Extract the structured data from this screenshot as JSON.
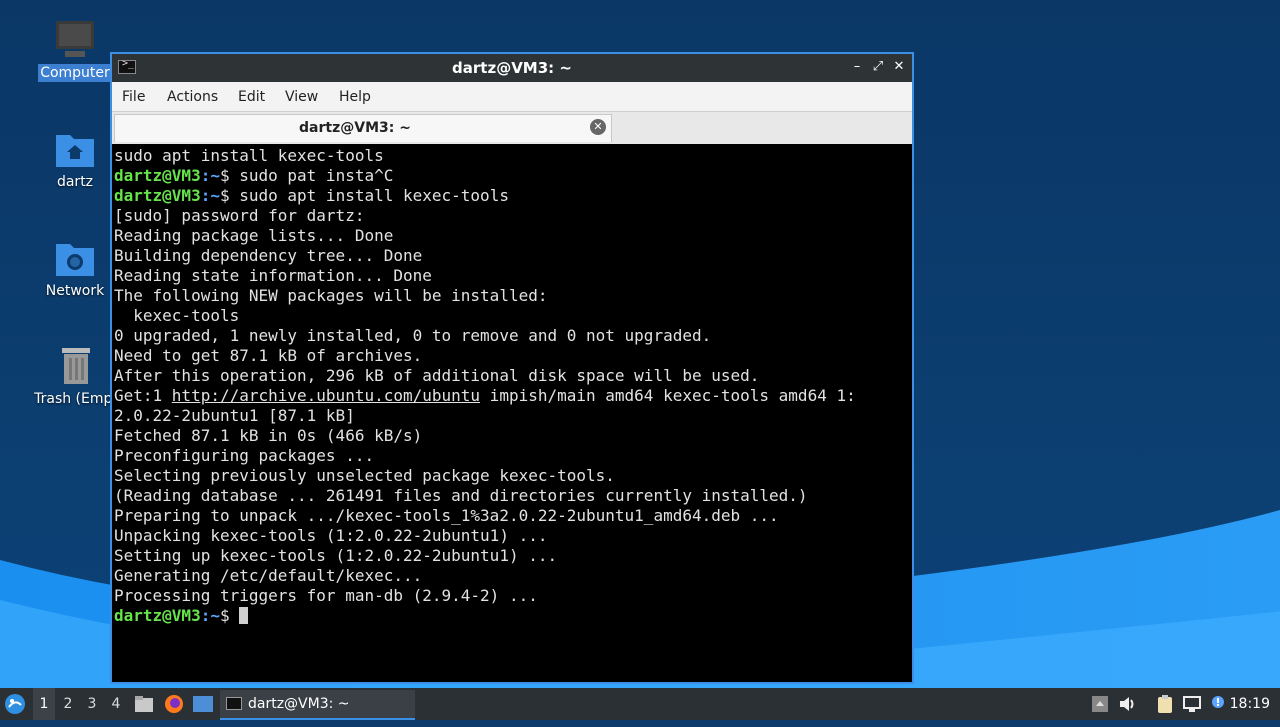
{
  "desktop": {
    "icons": [
      {
        "label": "Computer",
        "icon": "computer-icon",
        "selected": true
      },
      {
        "label": "dartz",
        "icon": "home-folder-icon"
      },
      {
        "label": "Network",
        "icon": "network-folder-icon"
      },
      {
        "label": "Trash (Empt",
        "icon": "trash-icon"
      }
    ]
  },
  "window": {
    "title": "dartz@VM3: ~",
    "menu": [
      "File",
      "Actions",
      "Edit",
      "View",
      "Help"
    ],
    "tab_title": "dartz@VM3: ~",
    "controls": [
      "minimize",
      "maximize",
      "close"
    ]
  },
  "terminal": {
    "prompt_user": "dartz@VM3",
    "prompt_path": ":~",
    "prompt_symbol": "$ ",
    "lines": [
      {
        "text": "sudo apt install kexec-tools"
      },
      {
        "prompt": true,
        "text": "sudo pat insta^C"
      },
      {
        "prompt": true,
        "text": "sudo apt install kexec-tools"
      },
      {
        "text": "[sudo] password for dartz:"
      },
      {
        "text": "Reading package lists... Done"
      },
      {
        "text": "Building dependency tree... Done"
      },
      {
        "text": "Reading state information... Done"
      },
      {
        "text": "The following NEW packages will be installed:"
      },
      {
        "text": "  kexec-tools"
      },
      {
        "text": "0 upgraded, 1 newly installed, 0 to remove and 0 not upgraded."
      },
      {
        "text": "Need to get 87.1 kB of archives."
      },
      {
        "text": "After this operation, 296 kB of additional disk space will be used."
      },
      {
        "text": "Get:1 ",
        "url": "http://archive.ubuntu.com/ubuntu",
        "rest": " impish/main amd64 kexec-tools amd64 1:"
      },
      {
        "text": "2.0.22-2ubuntu1 [87.1 kB]"
      },
      {
        "text": "Fetched 87.1 kB in 0s (466 kB/s)"
      },
      {
        "text": "Preconfiguring packages ..."
      },
      {
        "text": "Selecting previously unselected package kexec-tools."
      },
      {
        "text": "(Reading database ... 261491 files and directories currently installed.)"
      },
      {
        "text": "Preparing to unpack .../kexec-tools_1%3a2.0.22-2ubuntu1_amd64.deb ..."
      },
      {
        "text": "Unpacking kexec-tools (1:2.0.22-2ubuntu1) ..."
      },
      {
        "text": "Setting up kexec-tools (1:2.0.22-2ubuntu1) ..."
      },
      {
        "text": "Generating /etc/default/kexec..."
      },
      {
        "text": "Processing triggers for man-db (2.9.4-2) ..."
      },
      {
        "prompt": true,
        "text": "",
        "cursor": true
      }
    ]
  },
  "taskbar": {
    "workspaces": [
      "1",
      "2",
      "3",
      "4"
    ],
    "active_workspace": "1",
    "launchers": [
      "file-manager-icon",
      "firefox-icon",
      "show-desktop-icon"
    ],
    "window_button": "dartz@VM3: ~",
    "tray": [
      "updates-icon",
      "volume-icon",
      "clipboard-icon",
      "network-icon",
      "notification-icon"
    ],
    "clock": "18:19"
  },
  "colors": {
    "prompt_user": "#67e34b",
    "prompt_path": "#5aa3ff",
    "window_border": "#3b8fe4",
    "taskbar": "#2b3035"
  }
}
